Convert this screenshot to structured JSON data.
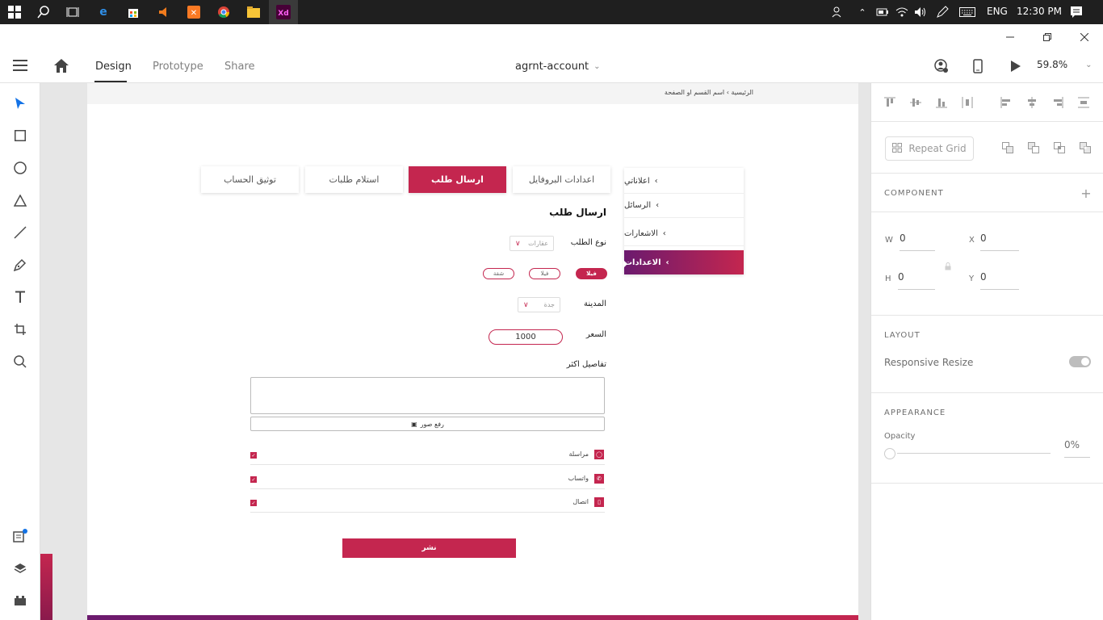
{
  "taskbar": {
    "language": "ENG",
    "time": "12:30 PM"
  },
  "header": {
    "tabs": [
      {
        "label": "Design",
        "active": true
      },
      {
        "label": "Prototype",
        "active": false
      },
      {
        "label": "Share",
        "active": false
      }
    ],
    "document_title": "agrnt-account",
    "zoom": "59.8%"
  },
  "artboard": {
    "breadcrumb": "الرئيسية  ›  اسم القسم او الصفحة",
    "tabs": [
      {
        "label": "اعدادات البروفايل",
        "active": false
      },
      {
        "label": "ارسال طلب",
        "active": true
      },
      {
        "label": "استلام طلبات",
        "active": false
      },
      {
        "label": "توثيق الحساب",
        "active": false
      }
    ],
    "side_menu": [
      {
        "label": "اعلاناتي",
        "active": false
      },
      {
        "label": "الرسائل",
        "active": false
      },
      {
        "label": "الاشعارات",
        "active": false
      },
      {
        "label": "الاعدادات",
        "active": true
      }
    ],
    "form": {
      "title": "ارسال طلب",
      "request_type_label": "نوع الطلب",
      "request_type_value": "عقارات",
      "property_types": [
        {
          "label": "فيلا",
          "active": true
        },
        {
          "label": "فيلا",
          "active": false
        },
        {
          "label": "شقة",
          "active": false
        }
      ],
      "city_label": "المدينة",
      "city_value": "جدة",
      "price_label": "السعر",
      "price_value": "1000",
      "details_label": "تفاصيل اكثر",
      "upload_label": "رفع صور",
      "contacts": [
        {
          "label": "مراسلة",
          "icon": "chat-icon",
          "checked": true
        },
        {
          "label": "واتساب",
          "icon": "whatsapp-icon",
          "checked": true
        },
        {
          "label": "اتصال",
          "icon": "phone-icon",
          "checked": true
        }
      ],
      "publish_label": "نشر"
    }
  },
  "right_panel": {
    "repeat_grid_label": "Repeat Grid",
    "component_title": "COMPONENT",
    "w_label": "W",
    "w_value": "0",
    "x_label": "X",
    "x_value": "0",
    "h_label": "H",
    "h_value": "0",
    "y_label": "Y",
    "y_value": "0",
    "layout_title": "LAYOUT",
    "responsive_resize_label": "Responsive Resize",
    "appearance_title": "APPEARANCE",
    "opacity_label": "Opacity",
    "opacity_value": "0%"
  },
  "colors": {
    "accent": "#c4264f",
    "gradient_start": "#6b1a6e"
  }
}
